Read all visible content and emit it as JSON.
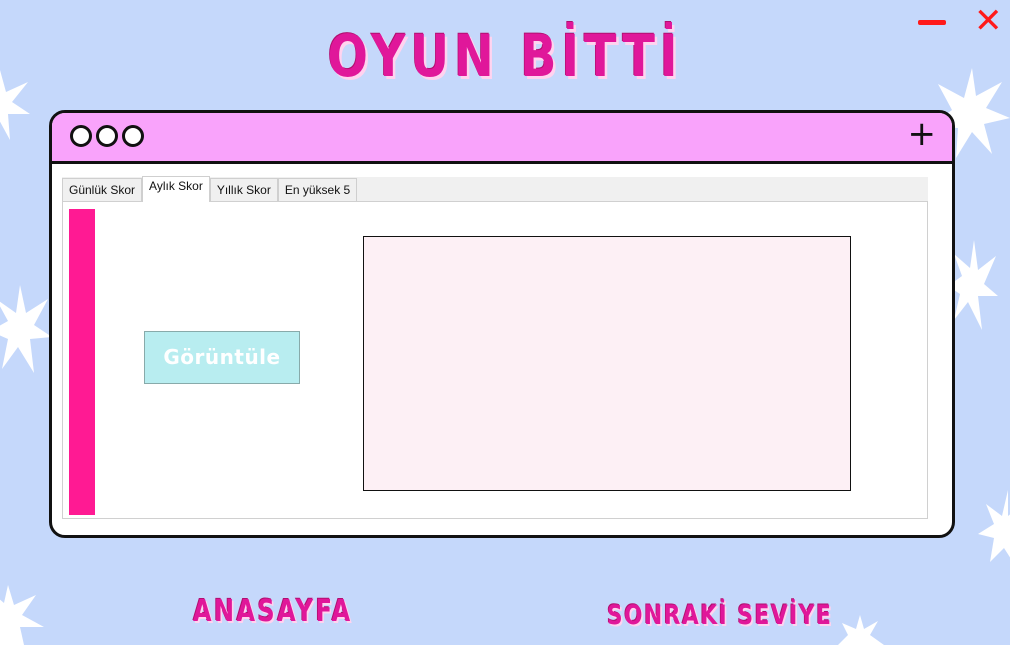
{
  "title": "OYUN BİTTİ",
  "window_controls": {
    "minimize_icon": "minus-icon",
    "close_icon": "close-x-icon",
    "close_glyph": "✕"
  },
  "app_window": {
    "plus_glyph": "+",
    "tabs": [
      {
        "label": "Günlük Skor",
        "active": false
      },
      {
        "label": "Aylık Skor",
        "active": true
      },
      {
        "label": "Yıllık Skor",
        "active": false
      },
      {
        "label": "En yüksek 5",
        "active": false
      }
    ],
    "view_button": "Görüntüle"
  },
  "nav": {
    "home": "ANASAYFA",
    "next_level": "SONRAKİ SEVİYE"
  },
  "colors": {
    "background": "#c5d8fb",
    "accent": "#e0179a",
    "titlebar": "#f9a3fb",
    "bar": "#ff1a93",
    "button": "#b8edf0",
    "panel": "#fdf0f5"
  }
}
